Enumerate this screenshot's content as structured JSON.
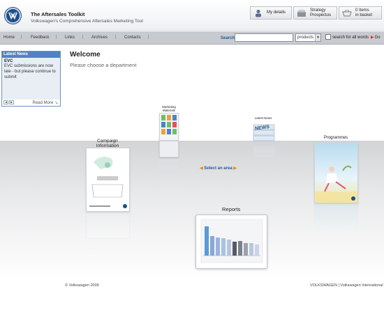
{
  "header": {
    "title": "The Aftersales Toolkit",
    "subtitle": "Volkswagen's Comprehensive Aftersales Marketing Tool",
    "my_details": "My details",
    "strategy_line1": "Strategy",
    "strategy_line2": "Prospectus",
    "basket_line1": "0 Items",
    "basket_line2": "in basket"
  },
  "nav": {
    "items": [
      "Home",
      "Feedback",
      "Links",
      "Archives",
      "Contacts"
    ],
    "separator": "|",
    "search_label": "Search",
    "search_value": "",
    "select_value": "products",
    "search_all_label": "search for all words",
    "go_label": "Go"
  },
  "news": {
    "heading": "Latest News",
    "item_title": "EVC",
    "item_text": "EVC submissions are now late - but please continue to submit",
    "read_more": "Read More"
  },
  "main": {
    "welcome": "Welcome",
    "instruction": "Please choose a department",
    "select_area": "Select an area",
    "departments": {
      "campaign_line1": "Campaign",
      "campaign_line2": "Information",
      "marketing_line1": "Marketing",
      "marketing_line2": "Materials",
      "news": "Latest News",
      "programmes": "Programmes",
      "reports": "Reports"
    }
  },
  "footer": {
    "copyright": "© Volkswagen 2009",
    "brand": "VOLKSWAGEN | Volkswagen International"
  },
  "colors": {
    "accent": "#235a9a",
    "news_header": "#4f83c4",
    "arrow": "#d53b1e"
  }
}
